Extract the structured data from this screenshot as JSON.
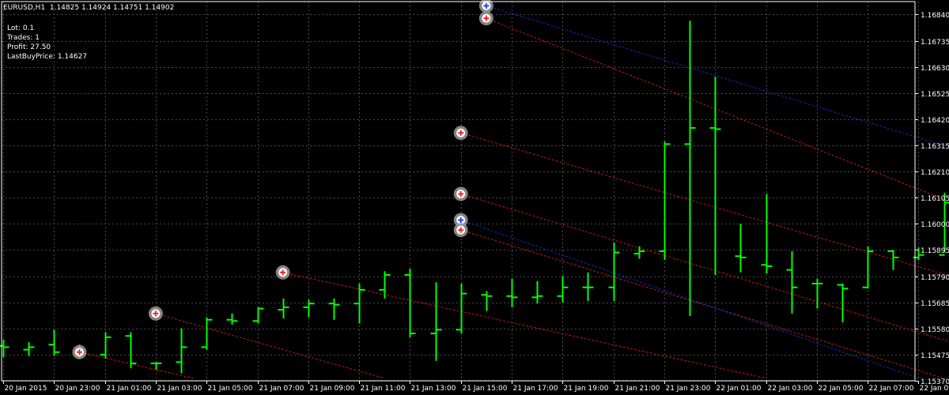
{
  "header": {
    "symbol_timeframe": "EURUSD,H1",
    "ohlc": "1.14825 1.14924 1.14751 1.14902"
  },
  "stats": [
    {
      "label": "Lot:",
      "value": "0.1"
    },
    {
      "label": "Trades:",
      "value": "1"
    },
    {
      "label": "Profit:",
      "value": "27.50"
    },
    {
      "label": "LastBuyPrice:",
      "value": "1.14627"
    }
  ],
  "colors": {
    "background": "#000000",
    "grid": "#4a4a4a",
    "bar": "#00ff00",
    "axis_text": "#ffffff",
    "trend_red": "#c81414",
    "trend_blue": "#1428c8",
    "marker_ring": "#9a9a9a",
    "marker_red": "#ff2020",
    "marker_blue": "#2040ff"
  },
  "chart_data": {
    "type": "ohlc",
    "ylim": [
      1.1537,
      1.16892
    ],
    "y_ticks": [
      "1.16840",
      "1.16735",
      "1.16630",
      "1.16525",
      "1.16420",
      "1.16315",
      "1.16210",
      "1.16105",
      "1.16000",
      "1.15895",
      "1.15790",
      "1.15685",
      "1.15580",
      "1.15475",
      "1.15370"
    ],
    "x_labels": [
      "20 Jan 2015",
      "20 Jan 23:00",
      "21 Jan 01:00",
      "21 Jan 03:00",
      "21 Jan 05:00",
      "21 Jan 07:00",
      "21 Jan 09:00",
      "21 Jan 11:00",
      "21 Jan 13:00",
      "21 Jan 15:00",
      "21 Jan 17:00",
      "21 Jan 19:00",
      "21 Jan 21:00",
      "21 Jan 23:00",
      "22 Jan 01:00",
      "22 Jan 03:00",
      "22 Jan 05:00",
      "22 Jan 07:00",
      "22 Jan 09:00"
    ],
    "bars": [
      {
        "o": 1.1551,
        "h": 1.15535,
        "l": 1.15465,
        "c": 1.15505
      },
      {
        "o": 1.15495,
        "h": 1.15525,
        "l": 1.1547,
        "c": 1.15505
      },
      {
        "o": 1.15515,
        "h": 1.15575,
        "l": 1.1547,
        "c": 1.15485
      },
      {
        "o": 1.1548,
        "h": 1.15515,
        "l": 1.1546,
        "c": 1.1548
      },
      {
        "o": 1.15475,
        "h": 1.15565,
        "l": 1.1546,
        "c": 1.15545
      },
      {
        "o": 1.1555,
        "h": 1.15565,
        "l": 1.1542,
        "c": 1.1544
      },
      {
        "o": 1.1544,
        "h": 1.15445,
        "l": 1.15415,
        "c": 1.1544
      },
      {
        "o": 1.15445,
        "h": 1.1558,
        "l": 1.154,
        "c": 1.15505
      },
      {
        "o": 1.15505,
        "h": 1.15625,
        "l": 1.15495,
        "c": 1.15615
      },
      {
        "o": 1.15615,
        "h": 1.1564,
        "l": 1.15595,
        "c": 1.1561
      },
      {
        "o": 1.1561,
        "h": 1.15665,
        "l": 1.156,
        "c": 1.1566
      },
      {
        "o": 1.15655,
        "h": 1.157,
        "l": 1.1562,
        "c": 1.15665
      },
      {
        "o": 1.15665,
        "h": 1.15695,
        "l": 1.15625,
        "c": 1.1568
      },
      {
        "o": 1.1568,
        "h": 1.157,
        "l": 1.15615,
        "c": 1.15675
      },
      {
        "o": 1.1568,
        "h": 1.1576,
        "l": 1.156,
        "c": 1.15735
      },
      {
        "o": 1.15735,
        "h": 1.1581,
        "l": 1.157,
        "c": 1.15795
      },
      {
        "o": 1.15795,
        "h": 1.1582,
        "l": 1.15545,
        "c": 1.1556
      },
      {
        "o": 1.1556,
        "h": 1.15765,
        "l": 1.1545,
        "c": 1.15575
      },
      {
        "o": 1.15575,
        "h": 1.1576,
        "l": 1.1556,
        "c": 1.1572
      },
      {
        "o": 1.15715,
        "h": 1.1573,
        "l": 1.1565,
        "c": 1.1571
      },
      {
        "o": 1.1571,
        "h": 1.1578,
        "l": 1.15665,
        "c": 1.15705
      },
      {
        "o": 1.15705,
        "h": 1.1577,
        "l": 1.1568,
        "c": 1.1571
      },
      {
        "o": 1.1571,
        "h": 1.1579,
        "l": 1.15685,
        "c": 1.15745
      },
      {
        "o": 1.15745,
        "h": 1.15805,
        "l": 1.1569,
        "c": 1.15745
      },
      {
        "o": 1.15745,
        "h": 1.15925,
        "l": 1.1569,
        "c": 1.15885
      },
      {
        "o": 1.1588,
        "h": 1.1591,
        "l": 1.1586,
        "c": 1.1589
      },
      {
        "o": 1.1589,
        "h": 1.1633,
        "l": 1.15855,
        "c": 1.1632
      },
      {
        "o": 1.1632,
        "h": 1.16815,
        "l": 1.1563,
        "c": 1.16385
      },
      {
        "o": 1.16385,
        "h": 1.1659,
        "l": 1.15795,
        "c": 1.1638
      },
      {
        "o": 1.1587,
        "h": 1.16,
        "l": 1.15805,
        "c": 1.15865
      },
      {
        "o": 1.15835,
        "h": 1.1612,
        "l": 1.158,
        "c": 1.1583
      },
      {
        "o": 1.15815,
        "h": 1.1589,
        "l": 1.1564,
        "c": 1.15745
      },
      {
        "o": 1.1576,
        "h": 1.1578,
        "l": 1.1566,
        "c": 1.1576
      },
      {
        "o": 1.15755,
        "h": 1.1576,
        "l": 1.15605,
        "c": 1.1574
      },
      {
        "o": 1.15745,
        "h": 1.1591,
        "l": 1.1574,
        "c": 1.1589
      },
      {
        "o": 1.1589,
        "h": 1.15895,
        "l": 1.15815,
        "c": 1.15865
      },
      {
        "o": 1.15865,
        "h": 1.15905,
        "l": 1.15855,
        "c": 1.15875
      },
      {
        "o": 1.15875,
        "h": 1.16125,
        "l": 1.15885,
        "c": 1.16085
      },
      {
        "o": 1.16085,
        "h": 1.1611,
        "l": 1.1608,
        "c": 1.16095
      },
      {
        "o": 1.16095,
        "h": 1.1614,
        "l": 1.1606,
        "c": 1.16135
      },
      {
        "o": 1.1614,
        "h": 1.1629,
        "l": 1.1605,
        "c": 1.16145
      },
      {
        "o": 1.16145,
        "h": 1.16155,
        "l": 1.1602,
        "c": 1.16145
      },
      {
        "o": 1.16145,
        "h": 1.16165,
        "l": 1.15935,
        "c": 1.1605
      },
      {
        "o": 1.16045,
        "h": 1.16175,
        "l": 1.1594,
        "c": 1.1598
      },
      {
        "o": 1.1598,
        "h": 1.1604,
        "l": 1.1596,
        "c": 1.1598
      },
      {
        "o": 1.15985,
        "h": 1.16055,
        "l": 1.1593,
        "c": 1.1604
      },
      {
        "o": 1.1604,
        "h": 1.1606,
        "l": 1.1603,
        "c": 1.16045
      },
      {
        "o": 1.1605,
        "h": 1.1607,
        "l": 1.1598,
        "c": 1.16055
      },
      {
        "o": 1.16055,
        "h": 1.1609,
        "l": 1.15975,
        "c": 1.15985
      },
      {
        "o": 1.1599,
        "h": 1.16015,
        "l": 1.15905,
        "c": 1.1599
      },
      {
        "o": 1.1599,
        "h": 1.16015,
        "l": 1.1586,
        "c": 1.1591
      },
      {
        "o": 1.15905,
        "h": 1.15915,
        "l": 1.15835,
        "c": 1.15905
      },
      {
        "o": 1.1591,
        "h": 1.15915,
        "l": 1.1576,
        "c": 1.15775
      },
      {
        "o": 1.15775,
        "h": 1.1579,
        "l": 1.1575,
        "c": 1.15765
      },
      {
        "o": 1.15765,
        "h": 1.1594,
        "l": 1.15735,
        "c": 1.1579
      }
    ],
    "trade_markers": [
      {
        "bar": 3,
        "price": 1.15485,
        "type": "buy"
      },
      {
        "bar": 6,
        "price": 1.1564,
        "type": "buy"
      },
      {
        "bar": 11,
        "price": 1.15805,
        "type": "buy"
      },
      {
        "bar": 18,
        "price": 1.16365,
        "type": "buy"
      },
      {
        "bar": 18,
        "price": 1.1612,
        "type": "buy"
      },
      {
        "bar": 18,
        "price": 1.16015,
        "type": "sell"
      },
      {
        "bar": 18,
        "price": 1.15975,
        "type": "buy"
      },
      {
        "bar": 19,
        "price": 1.16875,
        "type": "sell"
      },
      {
        "bar": 19,
        "price": 1.16825,
        "type": "buy"
      }
    ],
    "trend_lines": [
      {
        "color": "red",
        "from": {
          "bar": 3,
          "price": 1.15485
        },
        "to": {
          "bar": 7.5,
          "price": 1.1538
        }
      },
      {
        "color": "red",
        "from": {
          "bar": 6,
          "price": 1.1564
        },
        "to": {
          "bar": 15,
          "price": 1.1538
        }
      },
      {
        "color": "red",
        "from": {
          "bar": 11,
          "price": 1.15805
        },
        "to": {
          "bar": 30,
          "price": 1.1538
        }
      },
      {
        "color": "red",
        "from": {
          "bar": 18,
          "price": 1.16365
        },
        "to": {
          "bar": 51,
          "price": 1.1538
        }
      },
      {
        "color": "red",
        "from": {
          "bar": 18,
          "price": 1.1612
        },
        "to": {
          "bar": 42,
          "price": 1.1538
        }
      },
      {
        "color": "red",
        "from": {
          "bar": 18,
          "price": 1.15975
        },
        "to": {
          "bar": 37,
          "price": 1.1538
        }
      },
      {
        "color": "red",
        "from": {
          "bar": 19,
          "price": 1.16825
        },
        "to": {
          "bar": 54.8,
          "price": 1.1538
        }
      },
      {
        "color": "blue",
        "from": {
          "bar": 18,
          "price": 1.16015
        },
        "to": {
          "bar": 36,
          "price": 1.1538
        }
      },
      {
        "color": "blue",
        "from": {
          "bar": 19,
          "price": 1.16875
        },
        "to": {
          "bar": 54.8,
          "price": 1.1576
        }
      }
    ]
  }
}
